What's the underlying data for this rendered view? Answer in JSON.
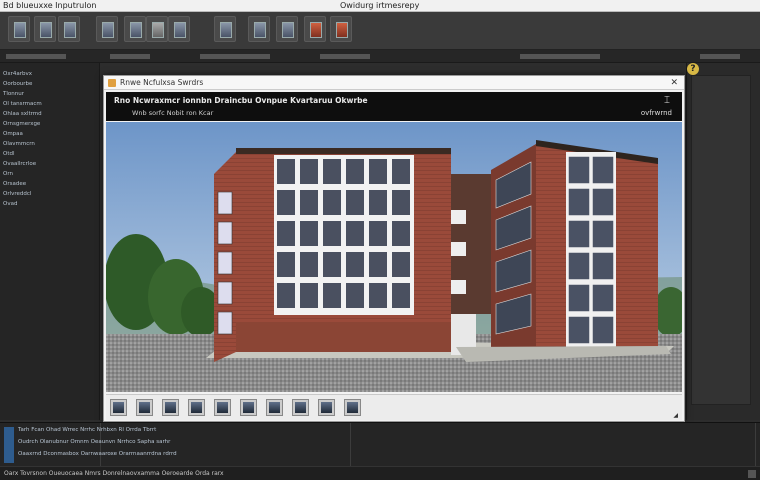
{
  "titlebar": {
    "app_name": "Bd blueuxxe Inputrulon",
    "window_title": "Owidurg irtmesrepy"
  },
  "toolbar": {
    "buttons": [
      {
        "icon": "document-icon"
      },
      {
        "icon": "layers-icon"
      },
      {
        "icon": "grid-icon"
      },
      {
        "icon": "panel-icon"
      },
      {
        "icon": "image-icon"
      },
      {
        "icon": "close-icon"
      },
      {
        "icon": "frame-icon"
      },
      {
        "icon": "stack-icon"
      },
      {
        "icon": "gallery-icon"
      },
      {
        "icon": "page-icon"
      },
      {
        "icon": "brush-icon"
      },
      {
        "icon": "color-icon"
      }
    ]
  },
  "left_panel": {
    "items": [
      "Oxr4arbvx",
      "Oorbourbe",
      "Tlonnur",
      "Ol tansrmacm",
      "Ohlaa sxltrmd",
      "Ornsgmerxge",
      "Ompaa",
      "Olavmmcrn",
      "Otdl",
      "Ovaallrcrloe",
      "Orn",
      "Orsadee",
      "Orlvreddcl",
      "Ovad"
    ]
  },
  "dialog": {
    "title": "Rnwe Ncfulxsa Swrdrs",
    "header_line1": "Rno  Ncwraxmcr ionnbn  Draincbu  Ovnpue  Kvartaruu Okwrbe",
    "header_line2": "Wnb  sorfc  Nobit ron  Kcar",
    "header_tools": "ovfrwrnd",
    "thumbnails": 10
  },
  "console": {
    "rows": [
      "Tarh  Fcan  Ohad  Wrrec  Nrrhc  Nrhbxn  Rl  Orrda  Tbrrt",
      "Oudrch  Olanubnur  Omnm  Oeaunvn  Nrrhco  Sapha  sarhr",
      "Oaaxrnd  Dconmasbox  Oarnwaaroxe  Orarrnaanrrdna  rdrrd"
    ]
  },
  "statusbar": {
    "text": "Oarx  Tovrsnon  Oueuocaea  Nmrs  Donrelnaovxamma  Oeroearde  Orda  rarx"
  }
}
